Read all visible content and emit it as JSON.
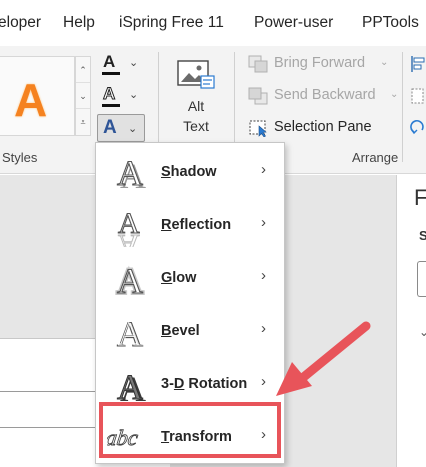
{
  "tabs": [
    "eloper",
    "Help",
    "iSpring Free 11",
    "Power-user",
    "PPTools"
  ],
  "ribbon": {
    "styles_group_label": "Styles",
    "gallery_sample_letter": "A",
    "text_fill_glyph": "A",
    "text_outline_glyph": "A",
    "text_effects_glyph": "A",
    "alt_text_line1": "Alt",
    "alt_text_line2": "Text",
    "bring_forward": "Bring Forward",
    "send_backward": "Send Backward",
    "selection_pane": "Selection Pane",
    "arrange_group_label": "Arrange"
  },
  "side_pane": {
    "title_fragment": "F",
    "section_fragment": "S"
  },
  "text_effects_menu": {
    "items": [
      {
        "label": "Shadow",
        "mnemonic": "S",
        "icon": "shadow-effect-icon"
      },
      {
        "label": "Reflection",
        "mnemonic": "R",
        "icon": "reflection-effect-icon"
      },
      {
        "label": "Glow",
        "mnemonic": "G",
        "icon": "glow-effect-icon"
      },
      {
        "label": "Bevel",
        "mnemonic": "B",
        "icon": "bevel-effect-icon"
      },
      {
        "label": "3-D Rotation",
        "mnemonic": "D",
        "icon": "3d-rotation-effect-icon"
      },
      {
        "label": "Transform",
        "mnemonic": "T",
        "icon": "transform-effect-icon"
      }
    ],
    "highlighted_item": "Transform"
  },
  "colors": {
    "ribbon_bg": "#f3f3f3",
    "accent_orange": "#f58220",
    "effects_blue": "#2f5597",
    "highlight_red": "#e8545a",
    "disabled_text": "#a6a6a6"
  }
}
